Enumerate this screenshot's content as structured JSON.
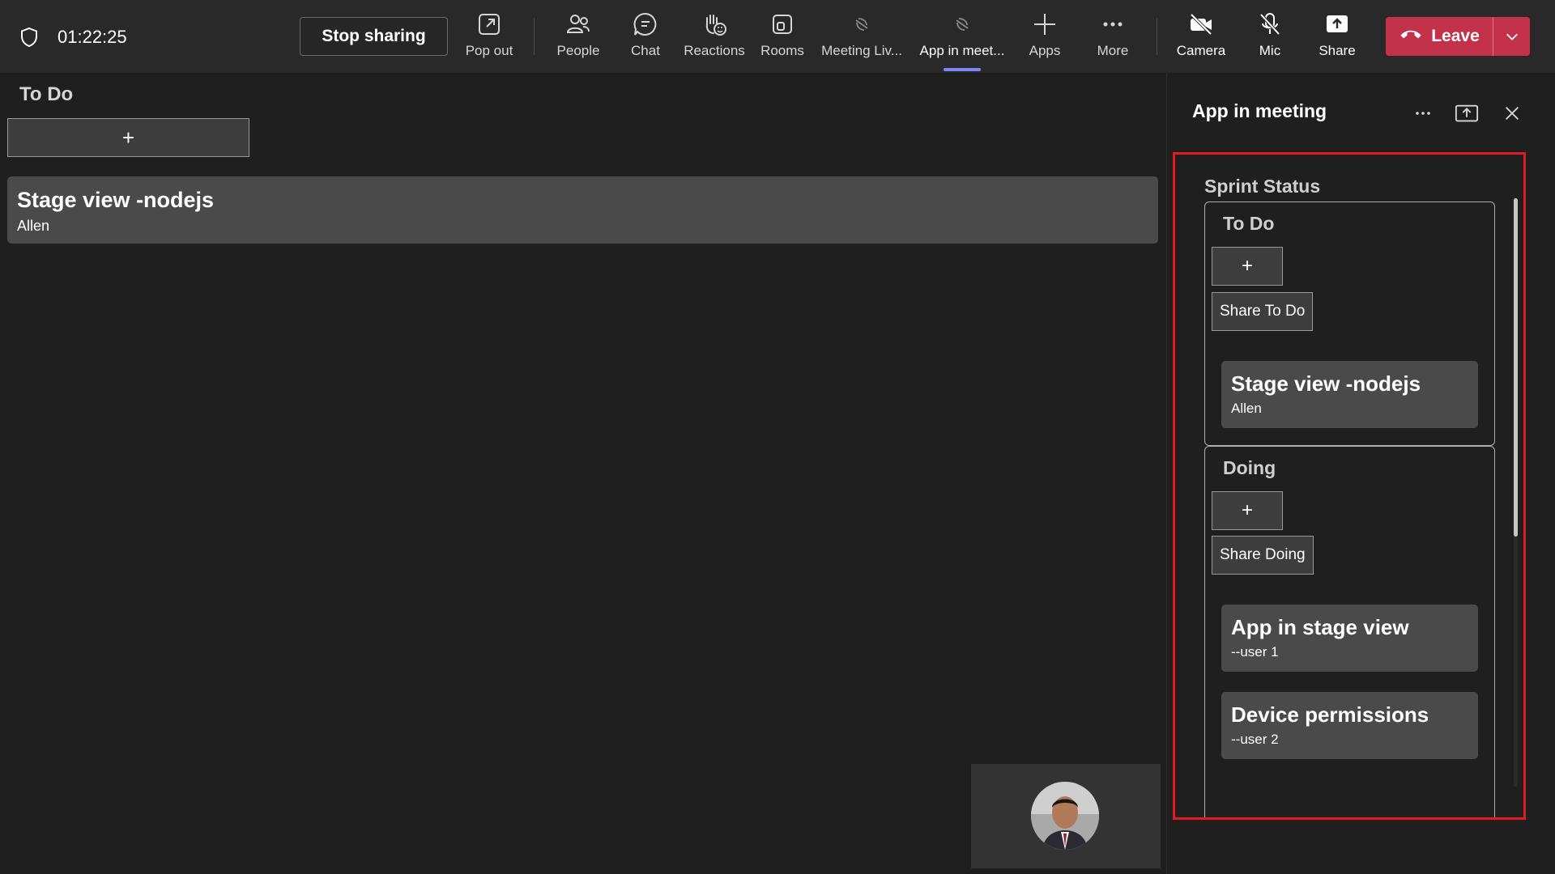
{
  "call": {
    "timer": "01:22:25",
    "stop_sharing_label": "Stop sharing"
  },
  "toolbar": {
    "items": [
      {
        "label": "Pop out",
        "icon": "pop-out-icon"
      },
      {
        "label": "People",
        "icon": "people-icon"
      },
      {
        "label": "Chat",
        "icon": "chat-icon"
      },
      {
        "label": "Reactions",
        "icon": "reactions-icon"
      },
      {
        "label": "Rooms",
        "icon": "rooms-icon"
      },
      {
        "label": "Meeting Liv...",
        "icon": "meeting-app-icon"
      },
      {
        "label": "App in meet...",
        "icon": "app-in-meeting-icon",
        "active": true
      },
      {
        "label": "Apps",
        "icon": "plus-icon"
      },
      {
        "label": "More",
        "icon": "more-icon"
      },
      {
        "label": "Camera",
        "icon": "camera-off-icon"
      },
      {
        "label": "Mic",
        "icon": "mic-off-icon"
      },
      {
        "label": "Share",
        "icon": "share-icon"
      }
    ],
    "leave_label": "Leave",
    "accent_color": "#7f85f5",
    "leave_color": "#c4314b"
  },
  "stage": {
    "column_title": "To Do",
    "add_symbol": "+",
    "card": {
      "title": "Stage view -nodejs",
      "subtitle": "Allen"
    }
  },
  "panel": {
    "title": "App in meeting",
    "sprint_title": "Sprint Status",
    "highlight_color": "#e21b23",
    "columns": [
      {
        "title": "To Do",
        "add_symbol": "+",
        "share_label": "Share To Do",
        "cards": [
          {
            "title": "Stage view -nodejs",
            "subtitle": "Allen"
          }
        ]
      },
      {
        "title": "Doing",
        "add_symbol": "+",
        "share_label": "Share Doing",
        "cards": [
          {
            "title": "App in stage view",
            "subtitle": "--user 1"
          },
          {
            "title": "Device permissions",
            "subtitle": "--user 2"
          }
        ]
      }
    ]
  }
}
